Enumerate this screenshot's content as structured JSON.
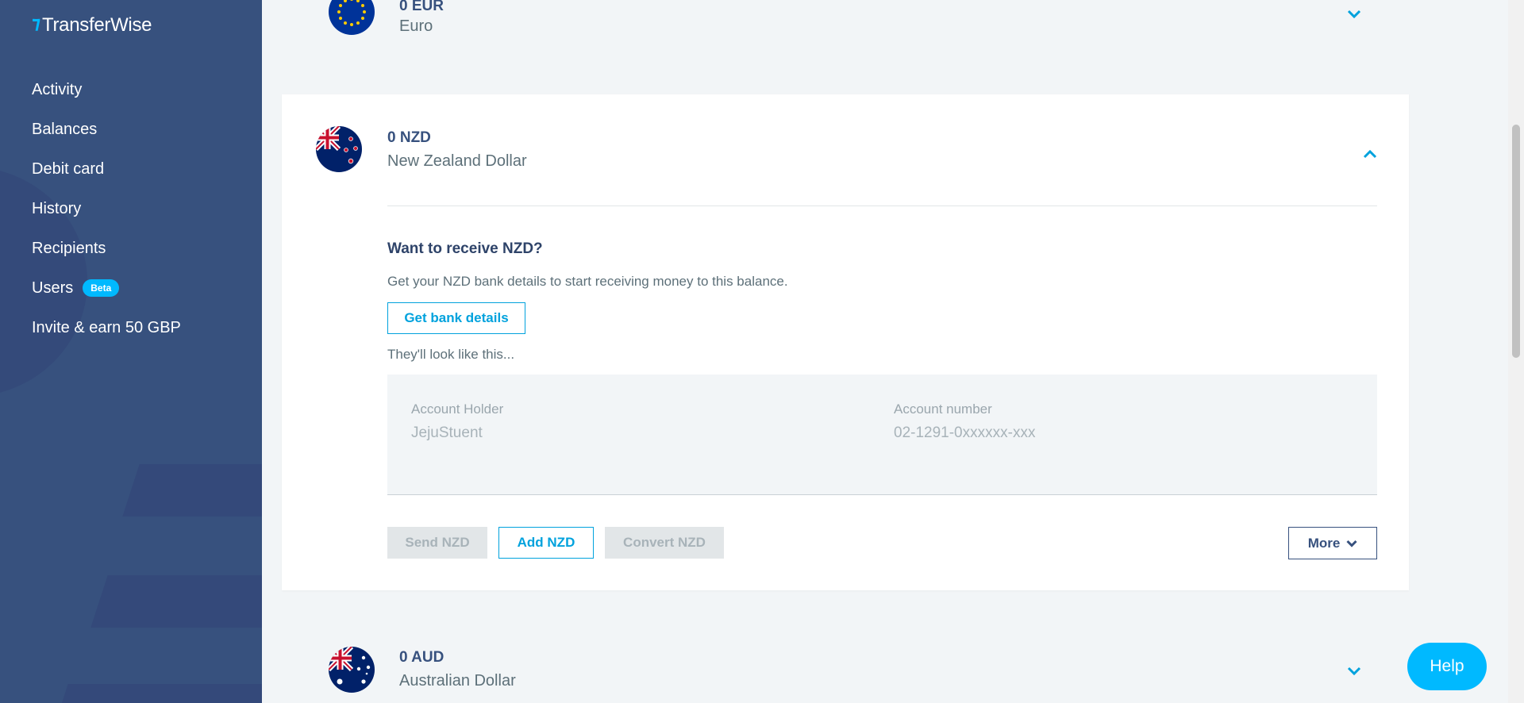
{
  "brand": {
    "name": "TransferWise",
    "mark": "⁊"
  },
  "nav": {
    "items": [
      {
        "label": "Activity"
      },
      {
        "label": "Balances"
      },
      {
        "label": "Debit card"
      },
      {
        "label": "History"
      },
      {
        "label": "Recipients"
      },
      {
        "label": "Users",
        "badge": "Beta"
      },
      {
        "label": "Invite & earn 50 GBP"
      }
    ]
  },
  "balances": {
    "eur": {
      "amount": "0 EUR",
      "name": "Euro"
    },
    "nzd": {
      "amount": "0 NZD",
      "name": "New Zealand Dollar",
      "receive_title": "Want to receive NZD?",
      "receive_desc": "Get your NZD bank details to start receiving money to this balance.",
      "get_details_label": "Get bank details",
      "look_like": "They'll look like this...",
      "preview": {
        "holder_label": "Account Holder",
        "holder_value": "JejuStuent",
        "number_label": "Account number",
        "number_value": "02-1291-0xxxxxx-xxx"
      },
      "actions": {
        "send": "Send NZD",
        "add": "Add NZD",
        "convert": "Convert NZD",
        "more": "More"
      }
    },
    "aud": {
      "amount": "0 AUD",
      "name": "Australian Dollar"
    }
  },
  "help_label": "Help",
  "colors": {
    "sidebar": "#37517e",
    "accent": "#00b9ff",
    "link": "#00a2dd",
    "background": "#f2f5f7"
  }
}
